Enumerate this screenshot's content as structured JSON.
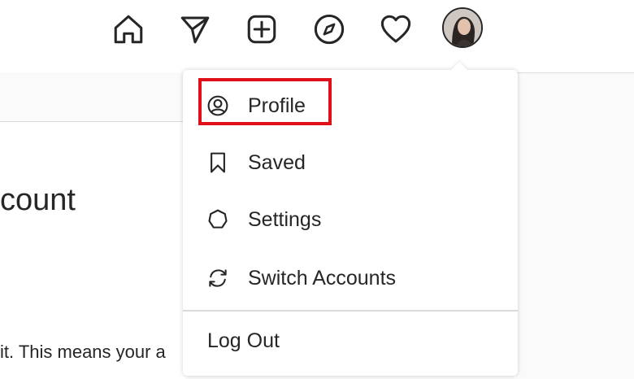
{
  "nav": {
    "icons": [
      "home-icon",
      "direct-message-icon",
      "new-post-icon",
      "explore-icon",
      "activity-heart-icon"
    ],
    "avatar": "profile-avatar"
  },
  "background": {
    "heading_fragment": "count",
    "body_fragment": "it. This means your a"
  },
  "menu": {
    "items": [
      {
        "label": "Profile",
        "icon": "profile-circle-icon"
      },
      {
        "label": "Saved",
        "icon": "bookmark-icon"
      },
      {
        "label": "Settings",
        "icon": "settings-gear-icon"
      },
      {
        "label": "Switch Accounts",
        "icon": "switch-accounts-icon"
      }
    ],
    "logout_label": "Log Out"
  },
  "highlight": {
    "target": "Profile",
    "color": "#e0101a"
  }
}
